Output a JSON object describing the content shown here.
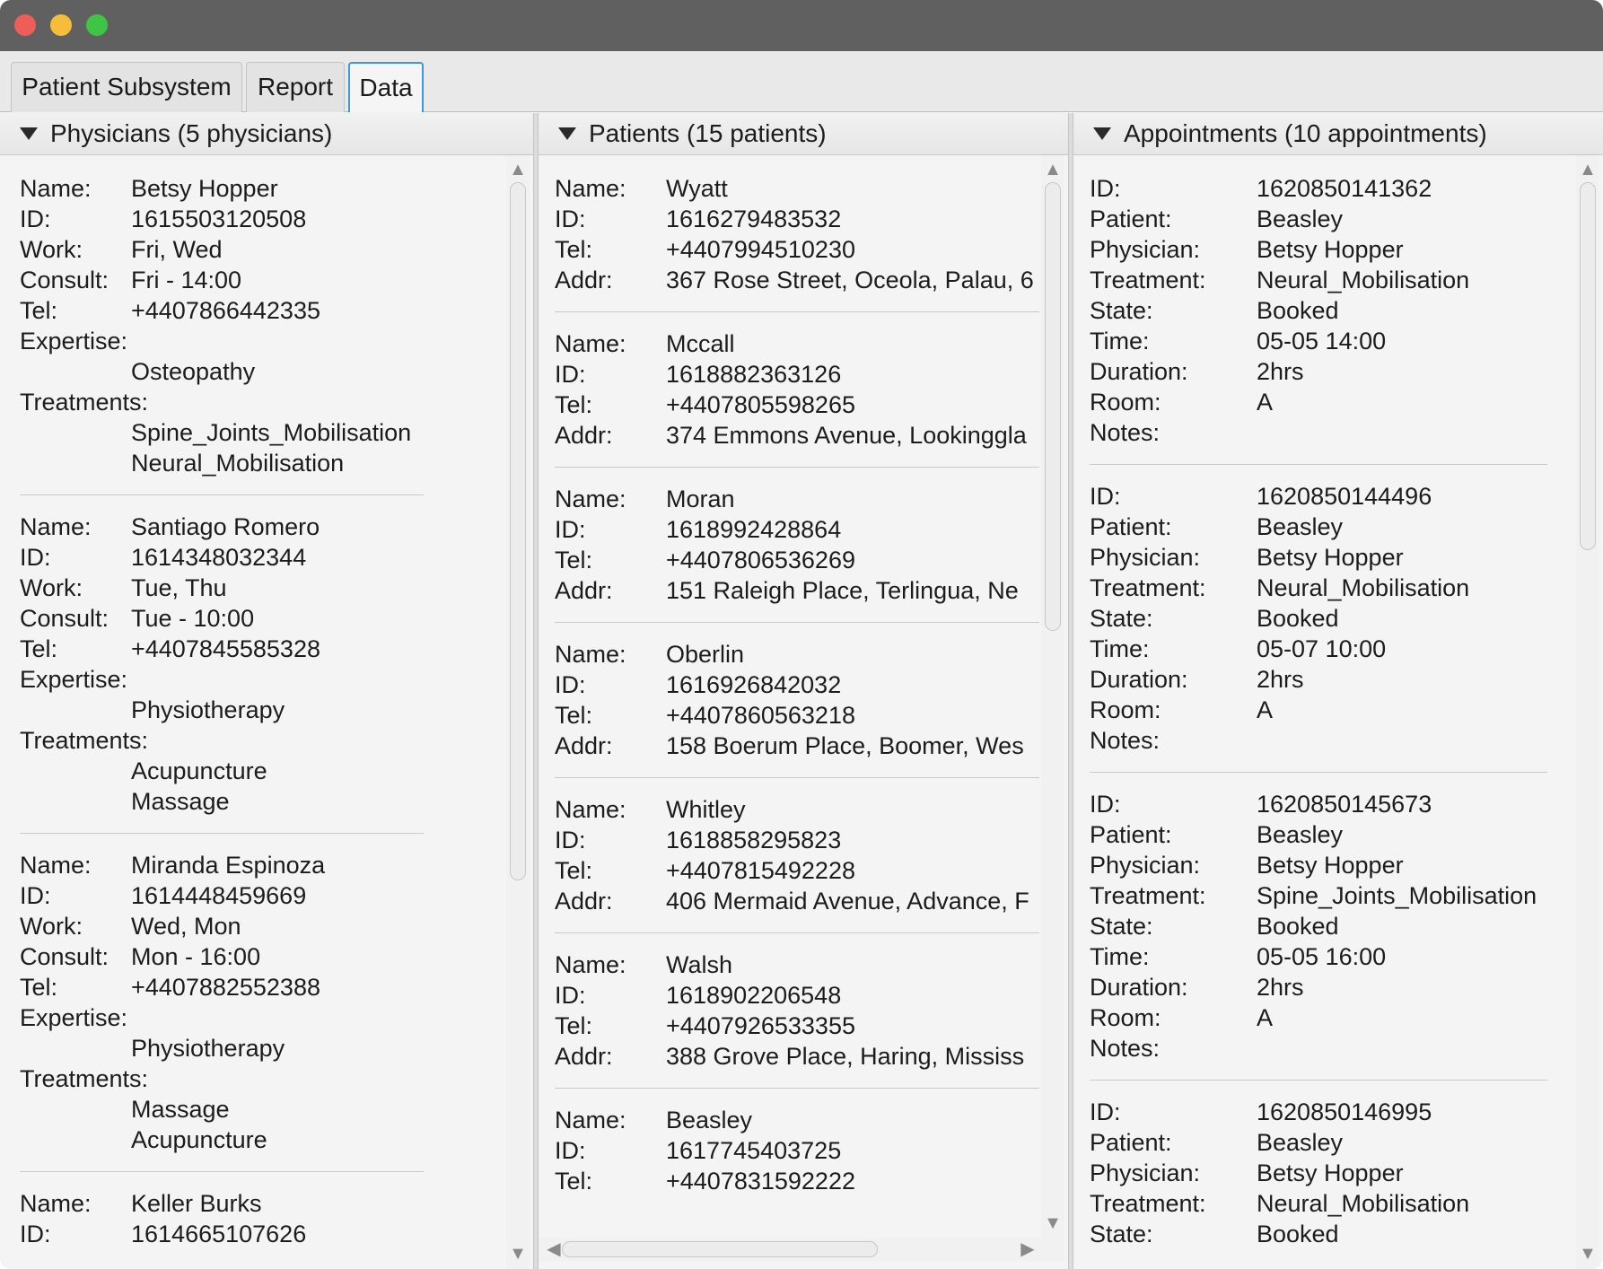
{
  "tabs": [
    {
      "label": "Patient Subsystem"
    },
    {
      "label": "Report"
    },
    {
      "label": "Data"
    }
  ],
  "physicians": {
    "title": "Physicians (5 physicians)",
    "items": [
      {
        "name": "Betsy Hopper",
        "id": "1615503120508",
        "work": "Fri, Wed",
        "consult": "Fri - 14:00",
        "tel": "+4407866442335",
        "expertise": "Osteopathy",
        "treatments": [
          "Spine_Joints_Mobilisation",
          "Neural_Mobilisation"
        ]
      },
      {
        "name": "Santiago Romero",
        "id": "1614348032344",
        "work": "Tue, Thu",
        "consult": "Tue - 10:00",
        "tel": "+4407845585328",
        "expertise": "Physiotherapy",
        "treatments": [
          "Acupuncture",
          "Massage"
        ]
      },
      {
        "name": "Miranda Espinoza",
        "id": "1614448459669",
        "work": "Wed, Mon",
        "consult": "Mon - 16:00",
        "tel": "+4407882552388",
        "expertise": "Physiotherapy",
        "treatments": [
          "Massage",
          "Acupuncture"
        ]
      },
      {
        "name": "Keller Burks",
        "id": "1614665107626"
      }
    ]
  },
  "patients": {
    "title": "Patients (15 patients)",
    "items": [
      {
        "name": "Wyatt",
        "id": "1616279483532",
        "tel": "+4407994510230",
        "addr": "367 Rose Street, Oceola, Palau, 6"
      },
      {
        "name": "Mccall",
        "id": "1618882363126",
        "tel": "+4407805598265",
        "addr": "374 Emmons Avenue, Lookinggla"
      },
      {
        "name": "Moran",
        "id": "1618992428864",
        "tel": "+4407806536269",
        "addr": "151 Raleigh Place, Terlingua, Ne"
      },
      {
        "name": "Oberlin",
        "id": "1616926842032",
        "tel": "+4407860563218",
        "addr": "158 Boerum Place, Boomer, Wes"
      },
      {
        "name": "Whitley",
        "id": "1618858295823",
        "tel": "+4407815492228",
        "addr": "406 Mermaid Avenue, Advance, F"
      },
      {
        "name": "Walsh",
        "id": "1618902206548",
        "tel": "+4407926533355",
        "addr": "388 Grove Place, Haring, Mississ"
      },
      {
        "name": "Beasley",
        "id": "1617745403725",
        "tel": "+4407831592222"
      }
    ]
  },
  "appointments": {
    "title": "Appointments (10 appointments)",
    "items": [
      {
        "id": "1620850141362",
        "patient": "Beasley",
        "physician": "Betsy Hopper",
        "treatment": "Neural_Mobilisation",
        "state": "Booked",
        "time": "05-05 14:00",
        "duration": "2hrs",
        "room": "A",
        "notes": ""
      },
      {
        "id": "1620850144496",
        "patient": "Beasley",
        "physician": "Betsy Hopper",
        "treatment": "Neural_Mobilisation",
        "state": "Booked",
        "time": "05-07 10:00",
        "duration": "2hrs",
        "room": "A",
        "notes": ""
      },
      {
        "id": "1620850145673",
        "patient": "Beasley",
        "physician": "Betsy Hopper",
        "treatment": "Spine_Joints_Mobilisation",
        "state": "Booked",
        "time": "05-05 16:00",
        "duration": "2hrs",
        "room": "A",
        "notes": ""
      },
      {
        "id": "1620850146995",
        "patient": "Beasley",
        "physician": "Betsy Hopper",
        "treatment": "Neural_Mobilisation",
        "state": "Booked"
      }
    ]
  },
  "labels": {
    "name": "Name:",
    "id": "ID:",
    "work": "Work:",
    "consult": "Consult:",
    "tel": "Tel:",
    "expertise": "Expertise:",
    "treatments": "Treatments:",
    "addr": "Addr:",
    "patient": "Patient:",
    "physician": "Physician:",
    "treatment": "Treatment:",
    "state": "State:",
    "time": "Time:",
    "duration": "Duration:",
    "room": "Room:",
    "notes": "Notes:"
  },
  "icons": {
    "scroll_up": "▲",
    "scroll_down": "▼",
    "scroll_left": "◀",
    "scroll_right": "▶"
  },
  "colors": {
    "titlebar": "#606060",
    "close": "#ee5e56",
    "minimize": "#f5bd3a",
    "maximize": "#3ec545",
    "active_tab_border": "#3b98dd"
  }
}
